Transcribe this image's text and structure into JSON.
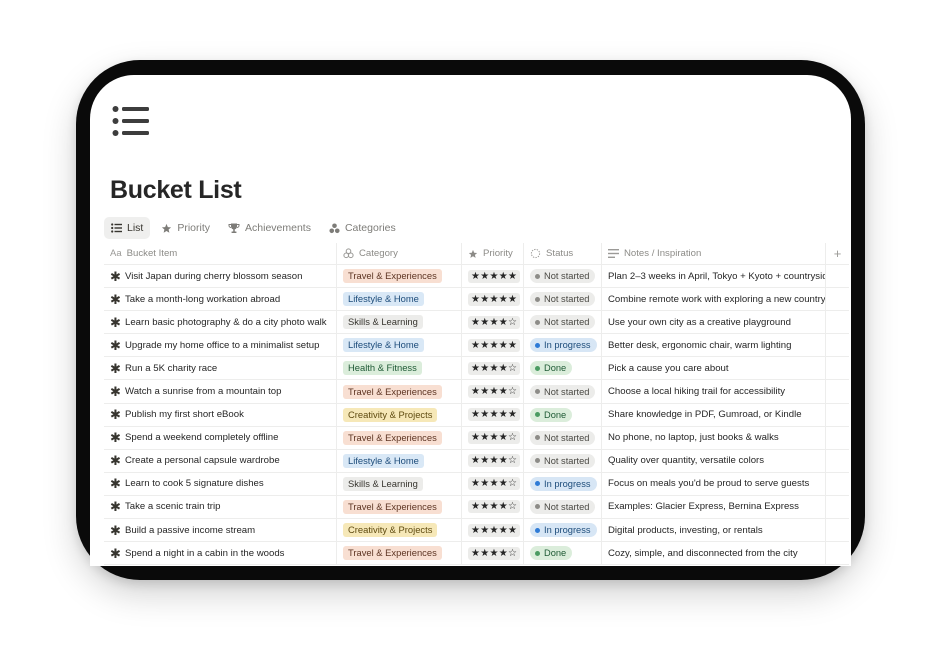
{
  "page": {
    "title": "Bucket List",
    "icon": "list-icon"
  },
  "tabs": [
    {
      "label": "List",
      "icon": "list-icon",
      "active": true
    },
    {
      "label": "Priority",
      "icon": "star-icon",
      "active": false
    },
    {
      "label": "Achievements",
      "icon": "trophy-icon",
      "active": false
    },
    {
      "label": "Categories",
      "icon": "shapes-icon",
      "active": false
    }
  ],
  "columns": {
    "item": "Bucket Item",
    "category": "Category",
    "priority": "Priority",
    "status": "Status",
    "notes": "Notes / Inspiration",
    "add": "+"
  },
  "colors": {
    "Travel & Experiences": "#f8dfd2",
    "Lifestyle & Home": "#d9e8f6",
    "Skills & Learning": "#ececea",
    "Health & Fitness": "#dbeddb",
    "Creativity & Projects": "#f6e8b8"
  },
  "rows": [
    {
      "item": "Visit Japan during cherry blossom season",
      "category": "Travel & Experiences",
      "priority": "★★★★★",
      "status": "Not started",
      "notes": "Plan 2–3 weeks in April, Tokyo + Kyoto + countryside"
    },
    {
      "item": "Take a month-long workation abroad",
      "category": "Lifestyle & Home",
      "priority": "★★★★★",
      "status": "Not started",
      "notes": "Combine remote work with exploring a new country"
    },
    {
      "item": "Learn basic photography & do a city photo walk",
      "category": "Skills & Learning",
      "priority": "★★★★☆",
      "status": "Not started",
      "notes": "Use your own city as a creative playground"
    },
    {
      "item": "Upgrade my home office to a minimalist setup",
      "category": "Lifestyle & Home",
      "priority": "★★★★★",
      "status": "In progress",
      "notes": "Better desk, ergonomic chair, warm lighting"
    },
    {
      "item": "Run a 5K charity race",
      "category": "Health & Fitness",
      "priority": "★★★★☆",
      "status": "Done",
      "notes": "Pick a cause you care about"
    },
    {
      "item": "Watch a sunrise from a mountain top",
      "category": "Travel & Experiences",
      "priority": "★★★★☆",
      "status": "Not started",
      "notes": "Choose a local hiking trail for accessibility"
    },
    {
      "item": "Publish my first short eBook",
      "category": "Creativity & Projects",
      "priority": "★★★★★",
      "status": "Done",
      "notes": "Share knowledge in PDF, Gumroad, or Kindle"
    },
    {
      "item": "Spend a weekend completely offline",
      "category": "Travel & Experiences",
      "priority": "★★★★☆",
      "status": "Not started",
      "notes": "No phone, no laptop, just books & walks"
    },
    {
      "item": "Create a personal capsule wardrobe",
      "category": "Lifestyle & Home",
      "priority": "★★★★☆",
      "status": "Not started",
      "notes": "Quality over quantity, versatile colors"
    },
    {
      "item": "Learn to cook 5 signature dishes",
      "category": "Skills & Learning",
      "priority": "★★★★☆",
      "status": "In progress",
      "notes": "Focus on meals you'd be proud to serve guests"
    },
    {
      "item": "Take a scenic train trip",
      "category": "Travel & Experiences",
      "priority": "★★★★☆",
      "status": "Not started",
      "notes": "Examples: Glacier Express, Bernina Express"
    },
    {
      "item": "Build a passive income stream",
      "category": "Creativity & Projects",
      "priority": "★★★★★",
      "status": "In progress",
      "notes": "Digital products, investing, or rentals"
    },
    {
      "item": "Spend a night in a cabin in the woods",
      "category": "Travel & Experiences",
      "priority": "★★★★☆",
      "status": "Done",
      "notes": "Cozy, simple, and disconnected from the city"
    }
  ]
}
